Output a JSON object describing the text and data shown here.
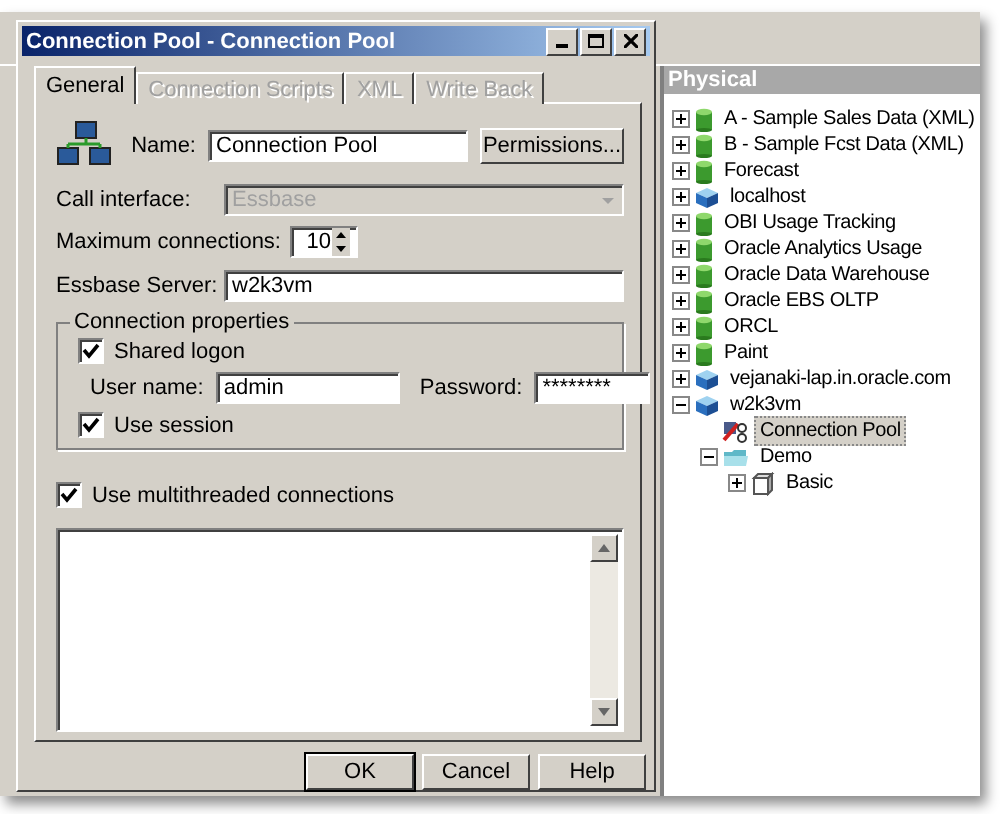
{
  "dialog": {
    "title": "Connection Pool - Connection Pool",
    "tabs": [
      {
        "label": "General",
        "selected": true,
        "disabled": false
      },
      {
        "label": "Connection Scripts",
        "selected": false,
        "disabled": true
      },
      {
        "label": "XML",
        "selected": false,
        "disabled": true
      },
      {
        "label": "Write Back",
        "selected": false,
        "disabled": true
      }
    ],
    "name": {
      "label": "Name:",
      "value": "Connection Pool"
    },
    "permissions_button": "Permissions...",
    "call_interface": {
      "label": "Call interface:",
      "value": "Essbase",
      "disabled": true
    },
    "max_connections": {
      "label": "Maximum connections:",
      "value": "10"
    },
    "essbase_server": {
      "label": "Essbase Server:",
      "value": "w2k3vm"
    },
    "connection_properties": {
      "legend": "Connection properties",
      "shared_logon": {
        "label": "Shared logon",
        "checked": true
      },
      "user_name": {
        "label": "User name:",
        "value": "admin"
      },
      "password": {
        "label": "Password:",
        "value": "********"
      },
      "use_session": {
        "label": "Use session",
        "checked": true
      }
    },
    "multithreaded": {
      "label": "Use multithreaded connections",
      "checked": true
    },
    "buttons": [
      "OK",
      "Cancel",
      "Help"
    ]
  },
  "physical": {
    "title": "Physical",
    "items": [
      {
        "label": "A - Sample Sales Data (XML)",
        "kind": "database",
        "expanded": false,
        "selected": false
      },
      {
        "label": "B - Sample Fcst Data (XML)",
        "kind": "database",
        "expanded": false,
        "selected": false
      },
      {
        "label": "Forecast",
        "kind": "database",
        "expanded": false,
        "selected": false
      },
      {
        "label": "localhost",
        "kind": "server",
        "expanded": false,
        "selected": false
      },
      {
        "label": "OBI Usage Tracking",
        "kind": "database",
        "expanded": false,
        "selected": false
      },
      {
        "label": "Oracle Analytics Usage",
        "kind": "database",
        "expanded": false,
        "selected": false
      },
      {
        "label": "Oracle Data Warehouse",
        "kind": "database",
        "expanded": false,
        "selected": false
      },
      {
        "label": "Oracle EBS OLTP",
        "kind": "database",
        "expanded": false,
        "selected": false
      },
      {
        "label": "ORCL",
        "kind": "database",
        "expanded": false,
        "selected": false
      },
      {
        "label": "Paint",
        "kind": "database",
        "expanded": false,
        "selected": false
      },
      {
        "label": "vejanaki-lap.in.oracle.com",
        "kind": "server",
        "expanded": false,
        "selected": false
      },
      {
        "label": "w2k3vm",
        "kind": "server",
        "expanded": true,
        "selected": false,
        "children": [
          {
            "label": "Connection Pool",
            "kind": "pool",
            "selected": true
          },
          {
            "label": "Demo",
            "kind": "folder",
            "expanded": true,
            "selected": false,
            "children": [
              {
                "label": "Basic",
                "kind": "cube",
                "expanded": false,
                "selected": false
              }
            ]
          }
        ]
      }
    ]
  }
}
